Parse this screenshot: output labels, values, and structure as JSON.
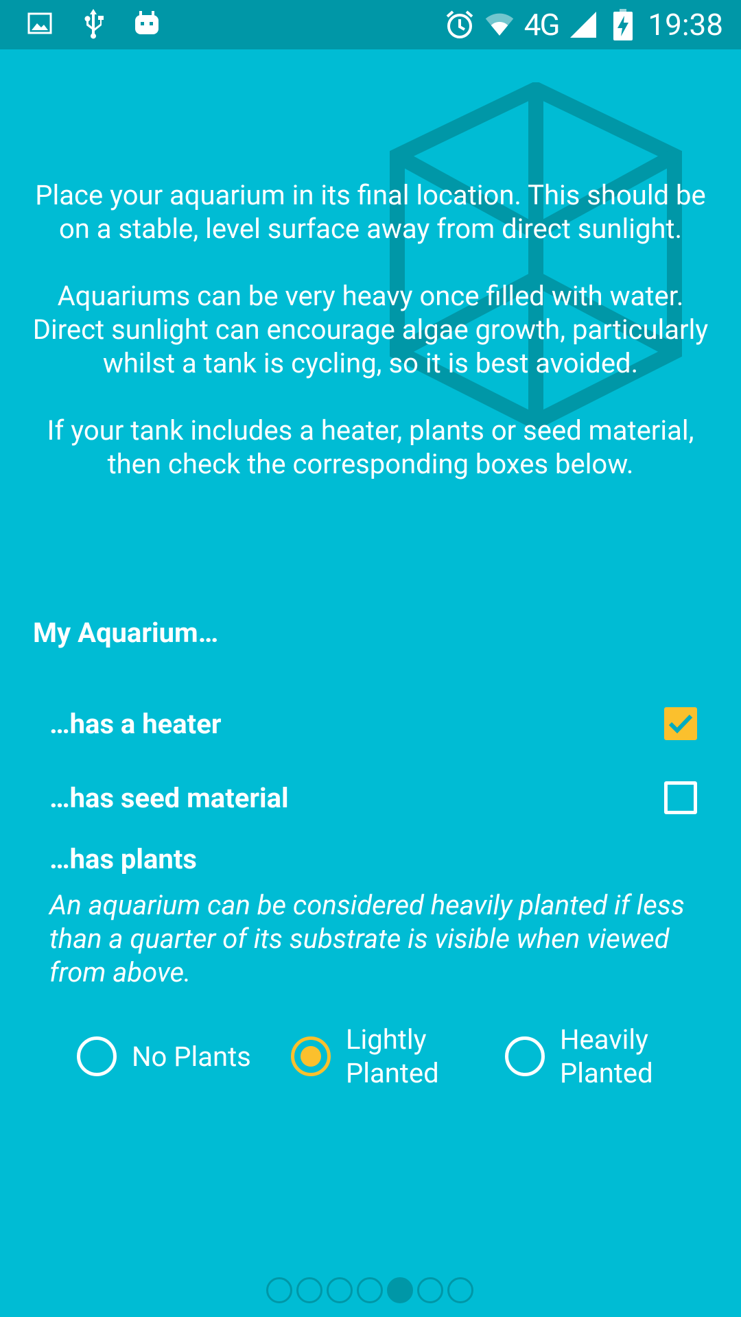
{
  "status_bar": {
    "icons_left": [
      "image-icon",
      "usb-icon",
      "android-debug-icon"
    ],
    "icons_right": [
      "alarm-icon",
      "wifi-icon",
      "cell-signal-icon",
      "battery-charging-icon"
    ],
    "network": "4G",
    "time": "19:38"
  },
  "intro": {
    "paragraph_1": "Place your aquarium in its final location. This should be on a stable, level surface away from direct sunlight.",
    "paragraph_2": "Aquariums can be very heavy once filled with water. Direct sunlight can encourage algae growth, particularly whilst a tank is cycling, so it is best avoided.",
    "paragraph_3": "If your tank includes a heater, plants or seed material, then check the corresponding boxes below."
  },
  "section_title": "My Aquarium…",
  "options": {
    "heater": {
      "label": "…has a heater",
      "checked": true
    },
    "seed": {
      "label": "…has seed material",
      "checked": false
    }
  },
  "plants": {
    "title": "…has plants",
    "description": "An aquarium can be considered heavily planted if less than a quarter of its substrate is visible when viewed from above.",
    "radios": [
      {
        "label": "No Plants",
        "selected": false
      },
      {
        "label": "Lightly Planted",
        "selected": true
      },
      {
        "label": "Heavily Planted",
        "selected": false
      }
    ]
  },
  "pager": {
    "pages": 7,
    "current": 5
  },
  "colors": {
    "background": "#00bcd4",
    "status_bar": "#0097a7",
    "accent": "#fbc02d",
    "watermark": "#0097a7"
  }
}
